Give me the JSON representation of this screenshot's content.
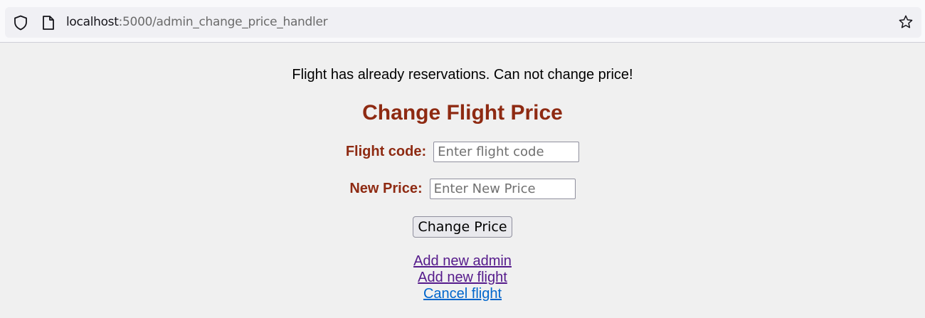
{
  "browser": {
    "url_host": "localhost",
    "url_path": ":5000/admin_change_price_handler"
  },
  "page": {
    "message": "Flight has already reservations. Can not change price!",
    "title": "Change Flight Price",
    "flight_code_label": "Flight code:",
    "flight_code_placeholder": "Enter flight code",
    "flight_code_value": "",
    "new_price_label": "New Price:",
    "new_price_placeholder": "Enter New Price",
    "new_price_value": "",
    "submit_label": "Change Price",
    "links": [
      {
        "label": "Add new admin"
      },
      {
        "label": "Add new flight"
      },
      {
        "label": "Cancel flight"
      }
    ]
  },
  "colors": {
    "title": "#8e2a12",
    "visited_link": "#551a8b",
    "link": "#0066cc",
    "background": "#f0f0f0"
  }
}
